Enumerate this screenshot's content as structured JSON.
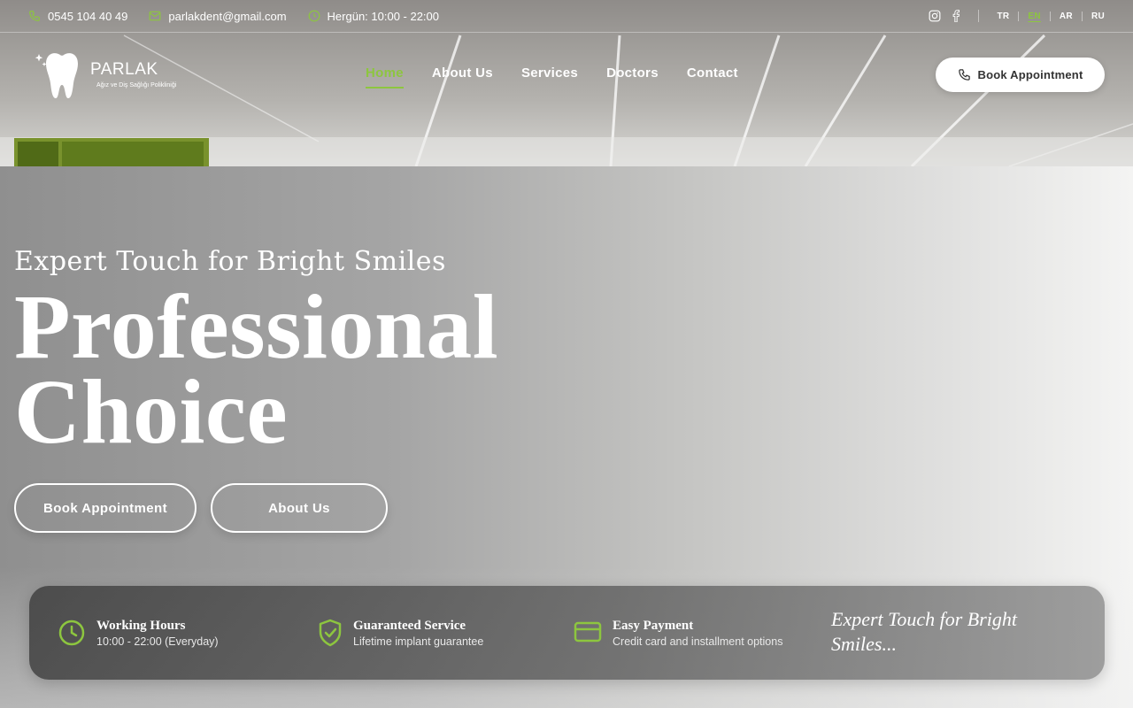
{
  "topbar": {
    "phone": "0545 104 40 49",
    "email": "parlakdent@gmail.com",
    "hours": "Hergün: 10:00 - 22:00",
    "languages": [
      "TR",
      "EN",
      "AR",
      "RU"
    ],
    "active_language": "EN"
  },
  "logo": {
    "name": "PARLAK",
    "subtitle": "Ağız ve Diş Sağlığı Polikliniği"
  },
  "nav": {
    "items": [
      {
        "label": "Home",
        "active": true
      },
      {
        "label": "About Us",
        "active": false
      },
      {
        "label": "Services",
        "active": false
      },
      {
        "label": "Doctors",
        "active": false
      },
      {
        "label": "Contact",
        "active": false
      }
    ],
    "book_button": "Book Appointment"
  },
  "hero": {
    "subtitle": "Expert Touch for Bright Smiles",
    "title_line1": "Professional",
    "title_line2": "Choice",
    "primary_button": "Book Appointment",
    "secondary_button": "About Us"
  },
  "infobar": {
    "features": [
      {
        "icon": "clock-icon",
        "title": "Working Hours",
        "desc": "10:00 - 22:00 (Everyday)"
      },
      {
        "icon": "shield-check-icon",
        "title": "Guaranteed Service",
        "desc": "Lifetime implant guarantee"
      },
      {
        "icon": "credit-card-icon",
        "title": "Easy Payment",
        "desc": "Credit card and installment options"
      }
    ],
    "slogan": "Expert Touch for Bright Smiles..."
  },
  "colors": {
    "accent": "#8dc63f",
    "text": "#ffffff",
    "button_text": "#333333"
  }
}
